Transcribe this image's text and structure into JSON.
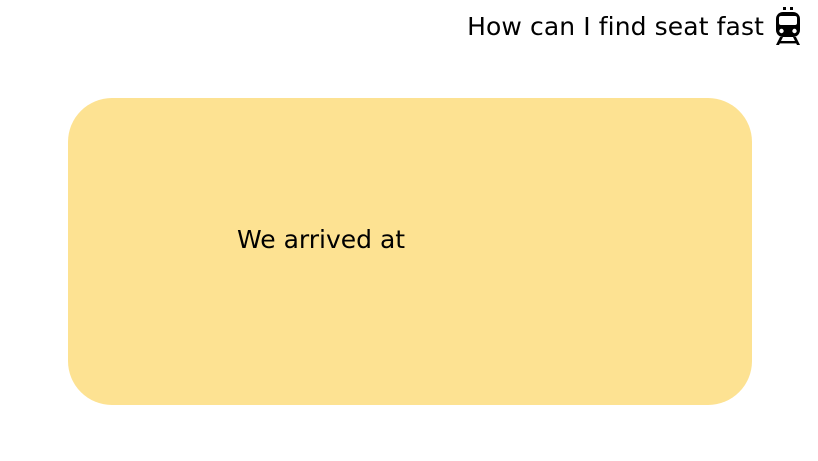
{
  "header": {
    "question": "How can I find seat fast",
    "icon": "tram-icon"
  },
  "card": {
    "text": "We arrived at",
    "color": "#FDE292"
  }
}
